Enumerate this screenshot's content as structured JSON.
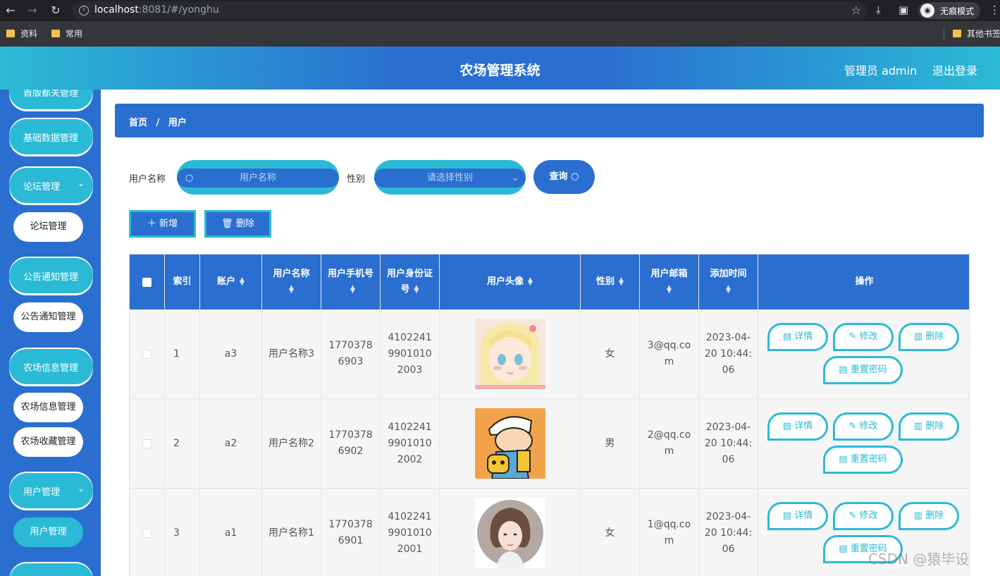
{
  "browser": {
    "url_host": "localhost",
    "url_rest": ":8081/#/yonghu",
    "incognito_label": "无痕模式",
    "bookmarks": [
      "资料",
      "常用"
    ],
    "other_bookmarks": "其他书签"
  },
  "header": {
    "title": "农场管理系统",
    "admin": "管理员 admin",
    "logout": "退出登录"
  },
  "sidebar": {
    "items": [
      {
        "label": "首版都关管理",
        "type": "menu"
      },
      {
        "label": "基础数据管理",
        "type": "menu"
      },
      {
        "label": "论坛管理",
        "type": "menu",
        "chevron": "⌄"
      },
      {
        "label": "论坛管理",
        "type": "sub"
      },
      {
        "label": "公告通知管理",
        "type": "menu"
      },
      {
        "label": "公告通知管理",
        "type": "sub"
      },
      {
        "label": "农场信息管理",
        "type": "menu"
      },
      {
        "label": "农场信息管理",
        "type": "sub"
      },
      {
        "label": "农场收藏管理",
        "type": "sub"
      },
      {
        "label": "用户管理",
        "type": "menu",
        "chevron": "⌄"
      },
      {
        "label": "用户管理",
        "type": "sub",
        "active": true
      }
    ]
  },
  "breadcrumb": {
    "home": "首页",
    "sep": "/",
    "current": "用户"
  },
  "search": {
    "name_label": "用户名称",
    "name_placeholder": "用户名称",
    "gender_label": "性别",
    "gender_placeholder": "请选择性别",
    "query_button": "查询"
  },
  "actions": {
    "add": "新增",
    "delete": "删除"
  },
  "table": {
    "headers": {
      "index": "索引",
      "account": "账户",
      "name": "用户名称",
      "phone": "用户手机号",
      "idcard": "用户身份证号",
      "avatar": "用户头像",
      "gender": "性别",
      "email": "用户邮箱",
      "time": "添加时间",
      "ops": "操作"
    },
    "rows": [
      {
        "index": "1",
        "account": "a3",
        "name": "用户名称3",
        "phone": "17703786903",
        "idcard": "410224199010102003",
        "gender": "女",
        "email": "3@qq.com",
        "time": "2023-04-20 10:44:06"
      },
      {
        "index": "2",
        "account": "a2",
        "name": "用户名称2",
        "phone": "17703786902",
        "idcard": "410224199010102002",
        "gender": "男",
        "email": "2@qq.com",
        "time": "2023-04-20 10:44:06"
      },
      {
        "index": "3",
        "account": "a1",
        "name": "用户名称1",
        "phone": "17703786901",
        "idcard": "410224199010102001",
        "gender": "女",
        "email": "1@qq.com",
        "time": "2023-04-20 10:44:06"
      }
    ],
    "op_labels": {
      "detail": "详情",
      "edit": "修改",
      "delete": "删除",
      "reset": "重置密码"
    }
  },
  "watermark": "CSDN @猿毕设",
  "colors": {
    "primary": "#2a6fd0",
    "accent": "#2bbad6"
  }
}
